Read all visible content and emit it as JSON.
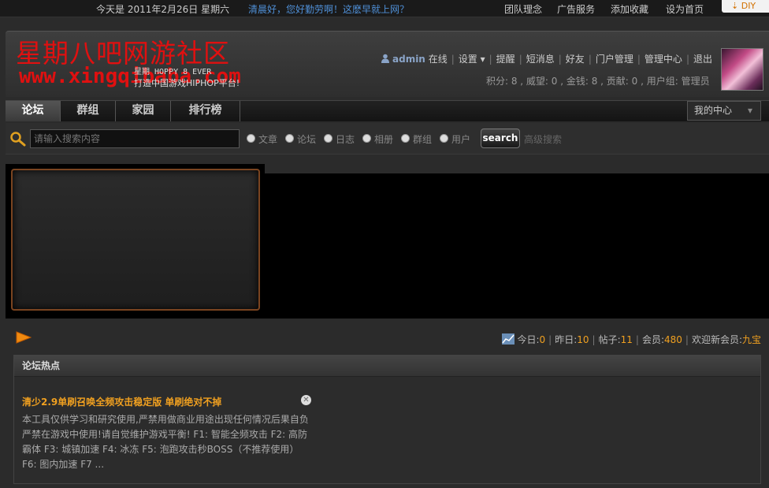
{
  "topbar": {
    "date": "今天是 2011年2月26日 星期六",
    "greeting": "清晨好，您好勤劳啊！这麽早就上网？",
    "links": [
      "团队理念",
      "广告服务",
      "添加收藏",
      "设为首页"
    ],
    "diy": "DIY"
  },
  "header": {
    "logo_cn": "星期八吧网游社区",
    "logo_url": "www.xingqibaba.com",
    "slogan1": "星期 HOPPY 8 EVER",
    "slogan2": "打造中国游戏HIPHOP平台!",
    "user": {
      "name": "admin",
      "status": "在线",
      "menu": [
        "设置",
        "提醒",
        "短消息",
        "好友",
        "门户管理",
        "管理中心",
        "退出"
      ]
    },
    "stats": "积分: 8 , 威望: 0 , 金钱: 8 , 贡献: 0 , 用户组: 管理员"
  },
  "nav": {
    "tabs": [
      "论坛",
      "群组",
      "家园",
      "排行榜"
    ],
    "mycenter": "我的中心"
  },
  "search": {
    "placeholder": "请输入搜索内容",
    "options": [
      "文章",
      "论坛",
      "日志",
      "相册",
      "群组",
      "用户"
    ],
    "button": "search",
    "advanced": "高级搜索"
  },
  "site_stats": {
    "today_label": "今日:",
    "today": "0",
    "yesterday_label": "昨日:",
    "yesterday": "10",
    "posts_label": "帖子:",
    "posts": "11",
    "members_label": "会员:",
    "members": "480",
    "newest_label": "欢迎新会员:",
    "newest": "九宝"
  },
  "hot": {
    "heading": "论坛热点",
    "title": "清少2.9单刷召唤全频攻击稳定版 单刷绝对不掉",
    "body": "本工具仅供学习和研究使用,严禁用做商业用途出现任何情况后果自负 严禁在游戏中使用!请自觉维护游戏平衡! F1: 智能全频攻击 F2: 高防霸体 F3: 城镇加速 F4: 冰冻 F5: 泡跑攻击秒BOSS（不推荐使用） F6: 图内加速 F7 ..."
  },
  "colors": {
    "accent": "#f0a020",
    "logo": "#e01010",
    "link": "#4f8fd6"
  }
}
